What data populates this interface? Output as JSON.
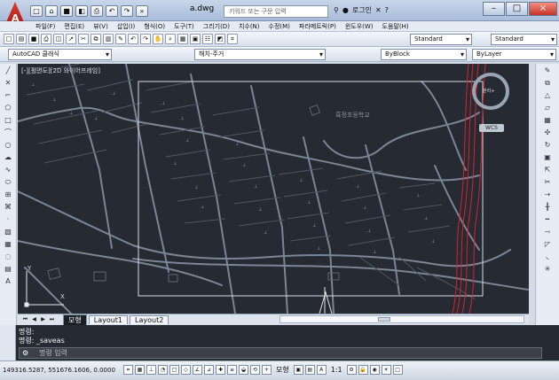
{
  "app": {
    "logo_text": "A",
    "document_title": "a.dwg",
    "search_placeholder": "키워드 또는 구문 입력",
    "login_label": "로그인",
    "help_label": "?"
  },
  "menu": [
    "파일(F)",
    "편집(E)",
    "뷰(V)",
    "삽입(I)",
    "형식(O)",
    "도구(T)",
    "그리기(D)",
    "치수(N)",
    "수정(M)",
    "파라메트릭(P)",
    "윈도우(W)",
    "도움말(H)"
  ],
  "toolbar": {
    "text_style": "Standard",
    "dim_style": "Standard",
    "workspace": "AutoCAD 클래식",
    "layer": "해치-주거",
    "color": "ByBlock",
    "linetype": "ByLayer"
  },
  "viewport": {
    "label": "[-][평면도][2D 와이어프레임]",
    "map_label": "흑정초등학교",
    "viewcube_label": "관리+",
    "wcs_label": "WCS"
  },
  "layout_tabs": [
    "모형",
    "Layout1",
    "Layout2"
  ],
  "command": {
    "history": [
      "명령:",
      "명령: _saveas"
    ],
    "placeholder": "명령 입력"
  },
  "status": {
    "coordinates": "149316.5287, 551676.1606, 0.0000",
    "model_label": "모형",
    "scale_label": "1:1"
  },
  "colors": {
    "canvas": "#252a33",
    "road": "#7b8595",
    "red_line": "#d8222a"
  }
}
